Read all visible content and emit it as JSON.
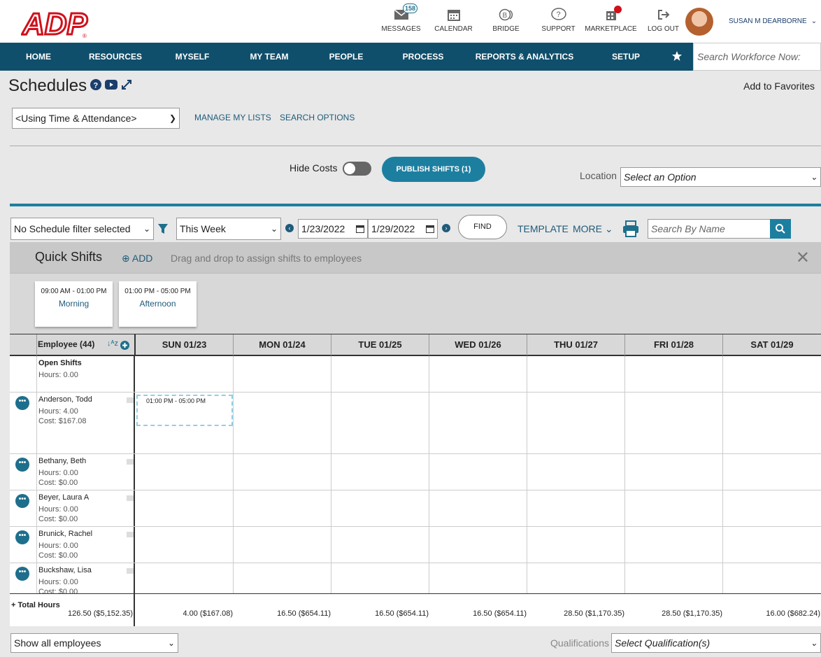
{
  "header": {
    "logo_text": "ADP",
    "icons": [
      {
        "label": "MESSAGES",
        "icon": "envelope-icon",
        "badge": "158"
      },
      {
        "label": "CALENDAR",
        "icon": "calendar-icon"
      },
      {
        "label": "BRIDGE",
        "icon": "bridge-icon"
      },
      {
        "label": "SUPPORT",
        "icon": "support-icon"
      },
      {
        "label": "MARKETPLACE",
        "icon": "marketplace-icon"
      },
      {
        "label": "LOG OUT",
        "icon": "logout-icon"
      }
    ],
    "user_name": "SUSAN M DEARBORNE"
  },
  "nav": {
    "items": [
      "HOME",
      "RESOURCES",
      "MYSELF",
      "MY TEAM",
      "PEOPLE",
      "PROCESS",
      "REPORTS & ANALYTICS",
      "SETUP"
    ],
    "search_placeholder": "Search Workforce Now:"
  },
  "page": {
    "title": "Schedules",
    "add_favorites": "Add to Favorites",
    "list_select": "<Using Time & Attendance>",
    "manage_lists": "MANAGE MY LISTS",
    "search_options": "SEARCH OPTIONS"
  },
  "controls": {
    "hide_costs_label": "Hide Costs",
    "hide_costs_on": false,
    "publish_label": "PUBLISH SHIFTS (1)",
    "location_label": "Location",
    "location_placeholder": "Select an Option",
    "filter_select": "No Schedule filter selected",
    "week_select": "This Week",
    "start_date": "1/23/2022",
    "end_date": "1/29/2022",
    "find_label": "FIND",
    "template_label": "TEMPLATE",
    "more_label": "MORE",
    "search_name_placeholder": "Search By Name"
  },
  "quick_shifts": {
    "title": "Quick Shifts",
    "add_label": "ADD",
    "hint": "Drag and drop to assign shifts to employees",
    "shifts": [
      {
        "time": "09:00 AM - 01:00 PM",
        "name": "Morning"
      },
      {
        "time": "01:00 PM - 05:00 PM",
        "name": "Afternoon"
      }
    ]
  },
  "grid": {
    "employee_header": "Employee (44)",
    "days": [
      "SUN 01/23",
      "MON 01/24",
      "TUE 01/25",
      "WED 01/26",
      "THU 01/27",
      "FRI 01/28",
      "SAT 01/29"
    ],
    "open_shifts": {
      "label": "Open Shifts",
      "hours": "Hours: 0.00"
    },
    "employees": [
      {
        "name": "Anderson, Todd",
        "hours": "Hours: 4.00",
        "cost": "Cost: $167.08"
      },
      {
        "name": "Bethany, Beth",
        "hours": "Hours: 0.00",
        "cost": "Cost: $0.00"
      },
      {
        "name": "Beyer, Laura A",
        "hours": "Hours: 0.00",
        "cost": "Cost: $0.00"
      },
      {
        "name": "Brunick, Rachel",
        "hours": "Hours: 0.00",
        "cost": "Cost: $0.00"
      },
      {
        "name": "Buckshaw, Lisa",
        "hours": "Hours: 0.00",
        "cost": "Cost: $0.00"
      }
    ],
    "assigned_shift": "01:00 PM - 05:00 PM",
    "total_label": "Total Hours",
    "total_all": "126.50 ($5,152.35)",
    "day_totals": [
      "4.00 ($167.08)",
      "16.50 ($654.11)",
      "16.50 ($654.11)",
      "16.50 ($654.11)",
      "28.50 ($1,170.35)",
      "28.50 ($1,170.35)",
      "16.00 ($682.24)"
    ]
  },
  "footer": {
    "show_select": "Show all employees",
    "qualifications_label": "Qualifications",
    "qualifications_placeholder": "Select Qualification(s)"
  }
}
